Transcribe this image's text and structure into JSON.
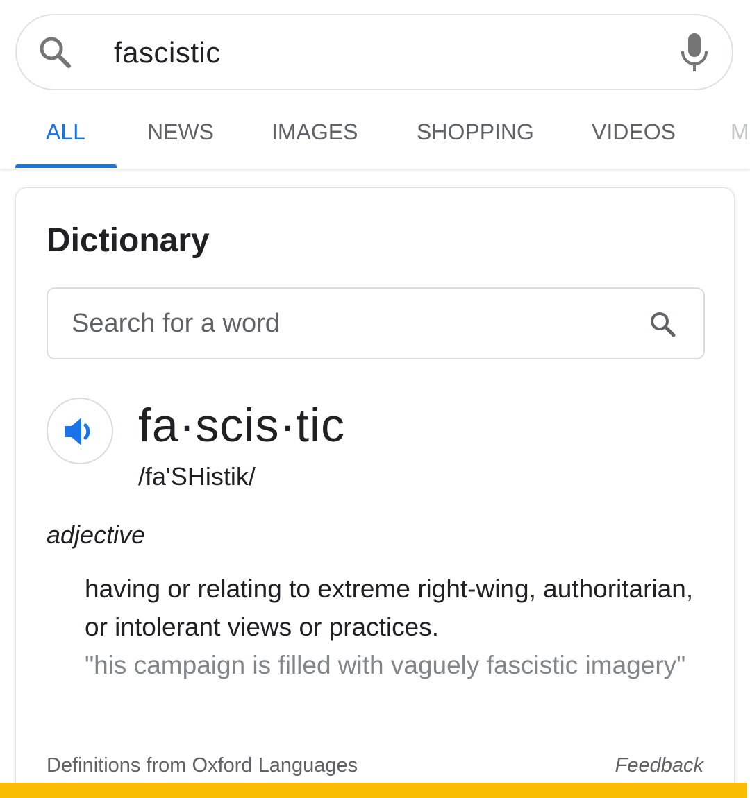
{
  "search": {
    "query": "fascistic"
  },
  "tabs": [
    {
      "label": "ALL",
      "active": true
    },
    {
      "label": "NEWS",
      "active": false
    },
    {
      "label": "IMAGES",
      "active": false
    },
    {
      "label": "SHOPPING",
      "active": false
    },
    {
      "label": "VIDEOS",
      "active": false
    },
    {
      "label": "M",
      "active": false
    }
  ],
  "dictionary": {
    "title": "Dictionary",
    "word_search_placeholder": "Search for a word",
    "headword": "fa·scis·tic",
    "phonetic": "/fa'SHistik/",
    "part_of_speech": "adjective",
    "definition": "having or relating to extreme right-wing, authoritarian, or intolerant views or practices.",
    "example": "\"his campaign is filled with vaguely fascistic imagery\"",
    "source": "Definitions from Oxford Languages",
    "feedback": "Feedback"
  },
  "colors": {
    "accent": "#1a73e8",
    "bottom_bar": "#fbbc04",
    "text": "#202124",
    "muted": "#5f6368"
  },
  "icons": [
    "search-icon",
    "mic-icon",
    "speaker-icon"
  ]
}
